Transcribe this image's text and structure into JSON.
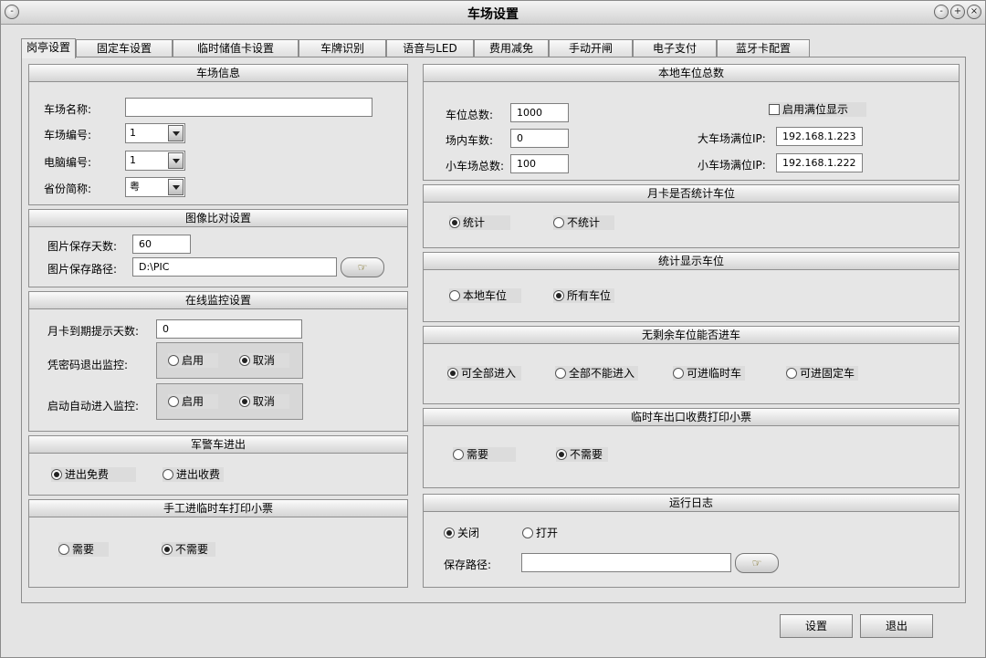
{
  "window": {
    "title": "车场设置",
    "ctrl_menu": "-",
    "ctrl_minimize": "-",
    "ctrl_restore": "+",
    "ctrl_close": "×"
  },
  "tabs": [
    "岗亭设置",
    "固定车设置",
    "临时储值卡设置",
    "车牌识别",
    "语音与LED",
    "费用减免",
    "手动开闸",
    "电子支付",
    "蓝牙卡配置"
  ],
  "lot_info": {
    "title": "车场信息",
    "name_label": "车场名称:",
    "name_value": "",
    "number_label": "车场编号:",
    "number_value": "1",
    "pc_label": "电脑编号:",
    "pc_value": "1",
    "province_label": "省份简称:",
    "province_value": "粤"
  },
  "image_compare": {
    "title": "图像比对设置",
    "days_label": "图片保存天数:",
    "days_value": "60",
    "path_label": "图片保存路径:",
    "path_value": "D:\\PIC",
    "browse_icon": "☞"
  },
  "online_monitor": {
    "title": "在线监控设置",
    "expire_label": "月卡到期提示天数:",
    "expire_value": "0",
    "pwd_exit_label": "凭密码退出监控:",
    "auto_enter_label": "启动自动进入监控:",
    "enable": "启用",
    "cancel": "取消"
  },
  "police": {
    "title": "军警车进出",
    "free": "进出免费",
    "charge": "进出收费"
  },
  "manual_ticket": {
    "title": "手工进临时车打印小票",
    "need": "需要",
    "no_need": "不需要"
  },
  "local_total": {
    "title": "本地车位总数",
    "total_label": "车位总数:",
    "total_value": "1000",
    "inside_label": "场内车数:",
    "inside_value": "0",
    "small_total_label": "小车场总数:",
    "small_total_value": "100",
    "full_display": "启用满位显示",
    "big_ip_label": "大车场满位IP:",
    "big_ip_value": "192.168.1.223",
    "small_ip_label": "小车场满位IP:",
    "small_ip_value": "192.168.1.222"
  },
  "monthly_count": {
    "title": "月卡是否统计车位",
    "count": "统计",
    "no_count": "不统计"
  },
  "stats_display": {
    "title": "统计显示车位",
    "local": "本地车位",
    "all": "所有车位"
  },
  "no_space": {
    "title": "无剩余车位能否进车",
    "all_in": "可全部进入",
    "none_in": "全部不能进入",
    "temp_in": "可进临时车",
    "fixed_in": "可进固定车"
  },
  "temp_exit_ticket": {
    "title": "临时车出口收费打印小票",
    "need": "需要",
    "no_need": "不需要"
  },
  "run_log": {
    "title": "运行日志",
    "off": "关闭",
    "on": "打开",
    "path_label": "保存路径:",
    "path_value": "",
    "browse_icon": "☞"
  },
  "buttons": {
    "set": "设置",
    "exit": "退出"
  }
}
